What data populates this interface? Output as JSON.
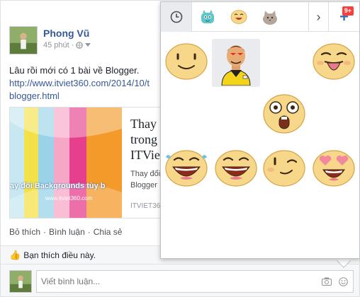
{
  "post": {
    "author": "Phong Vũ",
    "time": "45 phút",
    "text_line1": "Lâu rồi mới có 1 bài về Blogger.",
    "text_link": "http://www.itviet360.com/2014/10/t",
    "text_link2": "blogger.html",
    "card": {
      "title_line1": "Thay đ",
      "title_line2": "trong",
      "title_line3": "ITViet",
      "desc_line1": "Thay đổi",
      "desc_line2": "Blogger",
      "domain": "ITVIET36",
      "thumb_caption": "ay đổi Backgrounds tùy b",
      "thumb_url": "www.itviet360.com"
    },
    "actions": [
      "Bỏ thích",
      "Bình luận",
      "Chia sẻ"
    ],
    "like_summary": "Bạn thích điều này.",
    "comment_placeholder": "Viết bình luận..."
  },
  "sticker_panel": {
    "tabs": [
      {
        "icon": "clock-icon",
        "active": true
      },
      {
        "icon": "monster-sticker-pack-icon",
        "active": false
      },
      {
        "icon": "smiley-sticker-pack-icon",
        "active": false
      },
      {
        "icon": "cat-sticker-pack-icon",
        "active": false
      }
    ],
    "badge": "9+",
    "stickers": [
      "smile-sticker",
      "referee-man-sticker",
      "tongue-out-sticker",
      "shocked-sticker",
      "laugh-tears-sticker",
      "grin-sticker",
      "wink-sticker",
      "heart-eyes-sticker"
    ]
  },
  "colors": {
    "link": "#365899",
    "accent": "#4267b2",
    "badge": "#fa3e3e",
    "sticker_face": "#f7d78a"
  }
}
